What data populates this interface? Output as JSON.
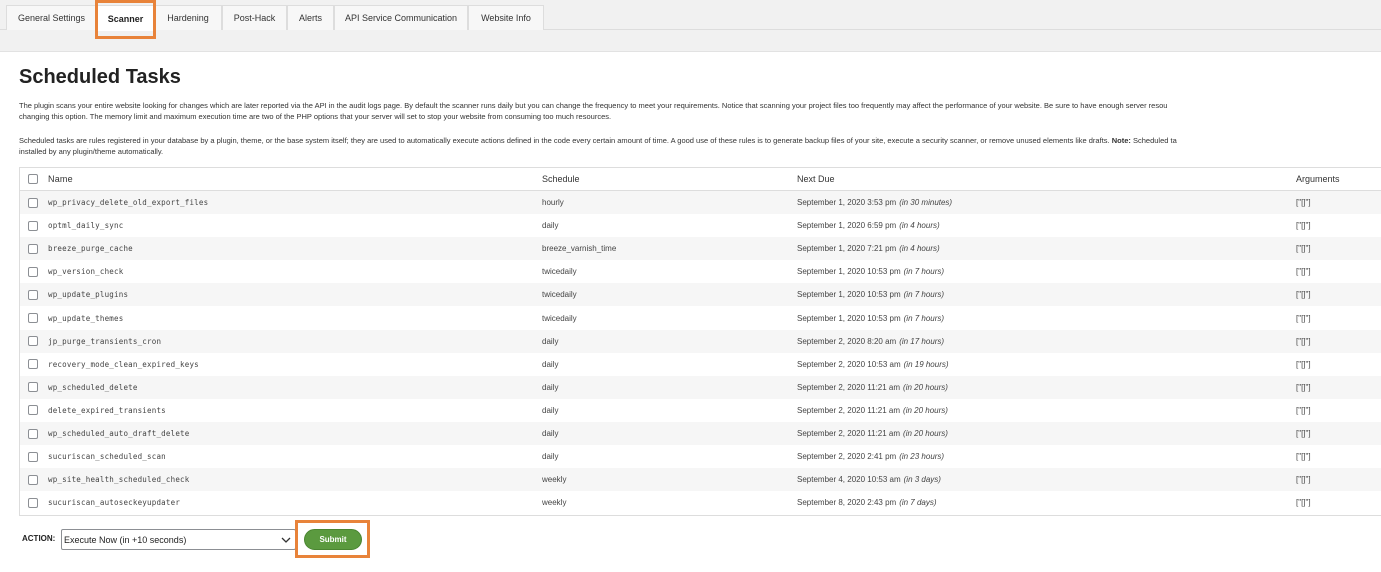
{
  "tabs": [
    {
      "label": "General Settings"
    },
    {
      "label": "Scanner"
    },
    {
      "label": "Hardening"
    },
    {
      "label": "Post-Hack"
    },
    {
      "label": "Alerts"
    },
    {
      "label": "API Service Communication"
    },
    {
      "label": "Website Info"
    }
  ],
  "active_tab": "Scanner",
  "page": {
    "title": "Scheduled Tasks",
    "para1_line1": "The plugin scans your entire website looking for changes which are later reported via the API in the audit logs page. By default the scanner runs daily but you can change the frequency to meet your requirements. Notice that scanning your project files too frequently may affect the performance of your website. Be sure to have enough server resou",
    "para1_line2": "changing this option. The memory limit and maximum execution time are two of the PHP options that your server will set to stop your website from consuming too much resources.",
    "para2_line1": "Scheduled tasks are rules registered in your database by a plugin, theme, or the base system itself; they are used to automatically execute actions defined in the code every certain amount of time. A good use of these rules is to generate backup files of your site, execute a security scanner, or remove unused elements like drafts.",
    "para2_note_label": "Note:",
    "para2_note_tail": "Scheduled ta",
    "para2_line2": "installed by any plugin/theme automatically."
  },
  "table": {
    "headers": {
      "name": "Name",
      "schedule": "Schedule",
      "next_due": "Next Due",
      "arguments": "Arguments"
    },
    "rows": [
      {
        "name": "wp_privacy_delete_old_export_files",
        "schedule": "hourly",
        "due": "September 1, 2020 3:53 pm",
        "rel": "(in 30 minutes)",
        "args": "[\"[]\"]"
      },
      {
        "name": "optml_daily_sync",
        "schedule": "daily",
        "due": "September 1, 2020 6:59 pm",
        "rel": "(in 4 hours)",
        "args": "[\"[]\"]"
      },
      {
        "name": "breeze_purge_cache",
        "schedule": "breeze_varnish_time",
        "due": "September 1, 2020 7:21 pm",
        "rel": "(in 4 hours)",
        "args": "[\"[]\"]"
      },
      {
        "name": "wp_version_check",
        "schedule": "twicedaily",
        "due": "September 1, 2020 10:53 pm",
        "rel": "(in 7 hours)",
        "args": "[\"[]\"]"
      },
      {
        "name": "wp_update_plugins",
        "schedule": "twicedaily",
        "due": "September 1, 2020 10:53 pm",
        "rel": "(in 7 hours)",
        "args": "[\"[]\"]"
      },
      {
        "name": "wp_update_themes",
        "schedule": "twicedaily",
        "due": "September 1, 2020 10:53 pm",
        "rel": "(in 7 hours)",
        "args": "[\"[]\"]"
      },
      {
        "name": "jp_purge_transients_cron",
        "schedule": "daily",
        "due": "September 2, 2020 8:20 am",
        "rel": "(in 17 hours)",
        "args": "[\"[]\"]"
      },
      {
        "name": "recovery_mode_clean_expired_keys",
        "schedule": "daily",
        "due": "September 2, 2020 10:53 am",
        "rel": "(in 19 hours)",
        "args": "[\"[]\"]"
      },
      {
        "name": "wp_scheduled_delete",
        "schedule": "daily",
        "due": "September 2, 2020 11:21 am",
        "rel": "(in 20 hours)",
        "args": "[\"[]\"]"
      },
      {
        "name": "delete_expired_transients",
        "schedule": "daily",
        "due": "September 2, 2020 11:21 am",
        "rel": "(in 20 hours)",
        "args": "[\"[]\"]"
      },
      {
        "name": "wp_scheduled_auto_draft_delete",
        "schedule": "daily",
        "due": "September 2, 2020 11:21 am",
        "rel": "(in 20 hours)",
        "args": "[\"[]\"]"
      },
      {
        "name": "sucuriscan_scheduled_scan",
        "schedule": "daily",
        "due": "September 2, 2020 2:41 pm",
        "rel": "(in 23 hours)",
        "args": "[\"[]\"]"
      },
      {
        "name": "wp_site_health_scheduled_check",
        "schedule": "weekly",
        "due": "September 4, 2020 10:53 am",
        "rel": "(in 3 days)",
        "args": "[\"[]\"]"
      },
      {
        "name": "sucuriscan_autoseckeyupdater",
        "schedule": "weekly",
        "due": "September 8, 2020 2:43 pm",
        "rel": "(in 7 days)",
        "args": "[\"[]\"]"
      }
    ]
  },
  "action": {
    "label": "ACTION:",
    "selected": "Execute Now (in +10 seconds)",
    "submit_label": "Submit"
  },
  "colors": {
    "highlight": "#e8833a",
    "submit_bg": "#5b9a3f"
  }
}
